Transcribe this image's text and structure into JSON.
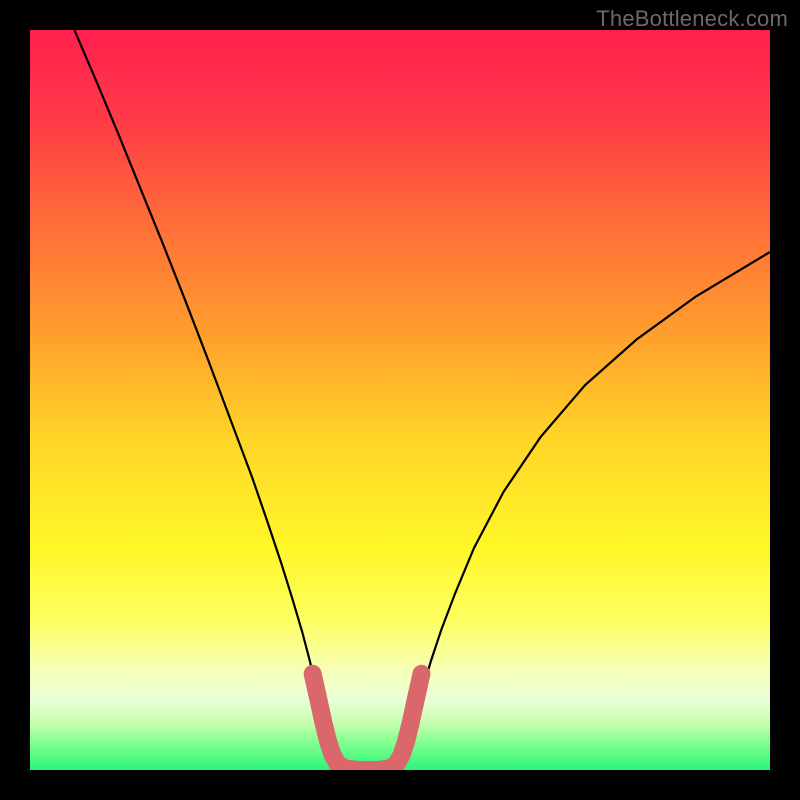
{
  "watermark": "TheBottleneck.com",
  "chart_data": {
    "type": "line",
    "title": "",
    "xlabel": "",
    "ylabel": "",
    "xlim": [
      0,
      1000
    ],
    "ylim": [
      0,
      1000
    ],
    "background_gradient": {
      "stops": [
        {
          "offset": 0.0,
          "color": "#ff1f4e"
        },
        {
          "offset": 0.12,
          "color": "#ff3a47"
        },
        {
          "offset": 0.25,
          "color": "#ff6a3a"
        },
        {
          "offset": 0.4,
          "color": "#ff9a2e"
        },
        {
          "offset": 0.55,
          "color": "#ffd427"
        },
        {
          "offset": 0.7,
          "color": "#fff728"
        },
        {
          "offset": 0.8,
          "color": "#fdff64"
        },
        {
          "offset": 0.86,
          "color": "#f7ffb0"
        },
        {
          "offset": 0.905,
          "color": "#eaffd8"
        },
        {
          "offset": 0.935,
          "color": "#c9ffb0"
        },
        {
          "offset": 0.965,
          "color": "#7dff8e"
        },
        {
          "offset": 1.0,
          "color": "#2bf57a"
        }
      ]
    },
    "series": [
      {
        "name": "bottleneck-curve",
        "color": "#000000",
        "width": 2.2,
        "points": [
          [
            60,
            1000
          ],
          [
            90,
            930
          ],
          [
            120,
            858
          ],
          [
            150,
            784
          ],
          [
            180,
            710
          ],
          [
            210,
            634
          ],
          [
            240,
            556
          ],
          [
            270,
            476
          ],
          [
            300,
            396
          ],
          [
            320,
            338
          ],
          [
            340,
            278
          ],
          [
            355,
            230
          ],
          [
            368,
            186
          ],
          [
            378,
            148
          ],
          [
            386,
            114
          ],
          [
            392,
            86
          ],
          [
            397,
            62
          ],
          [
            401,
            44
          ],
          [
            404,
            30
          ],
          [
            407,
            20
          ],
          [
            410,
            12
          ],
          [
            414,
            6
          ],
          [
            420,
            2
          ],
          [
            430,
            0
          ],
          [
            455,
            0
          ],
          [
            480,
            0
          ],
          [
            490,
            2
          ],
          [
            496,
            6
          ],
          [
            501,
            12
          ],
          [
            505,
            20
          ],
          [
            509,
            30
          ],
          [
            513,
            44
          ],
          [
            518,
            62
          ],
          [
            524,
            86
          ],
          [
            532,
            114
          ],
          [
            542,
            148
          ],
          [
            556,
            190
          ],
          [
            575,
            240
          ],
          [
            600,
            300
          ],
          [
            640,
            376
          ],
          [
            690,
            450
          ],
          [
            750,
            520
          ],
          [
            820,
            582
          ],
          [
            900,
            640
          ],
          [
            1000,
            700
          ]
        ]
      },
      {
        "name": "sweet-spot-highlight",
        "color": "#d9676b",
        "width": 18,
        "linecap": "round",
        "points": [
          [
            382,
            130
          ],
          [
            390,
            94
          ],
          [
            397,
            62
          ],
          [
            403,
            38
          ],
          [
            409,
            20
          ],
          [
            416,
            8
          ],
          [
            426,
            2
          ],
          [
            444,
            0
          ],
          [
            470,
            0
          ],
          [
            486,
            2
          ],
          [
            495,
            8
          ],
          [
            502,
            20
          ],
          [
            508,
            38
          ],
          [
            514,
            62
          ],
          [
            521,
            94
          ],
          [
            529,
            130
          ]
        ]
      }
    ]
  }
}
